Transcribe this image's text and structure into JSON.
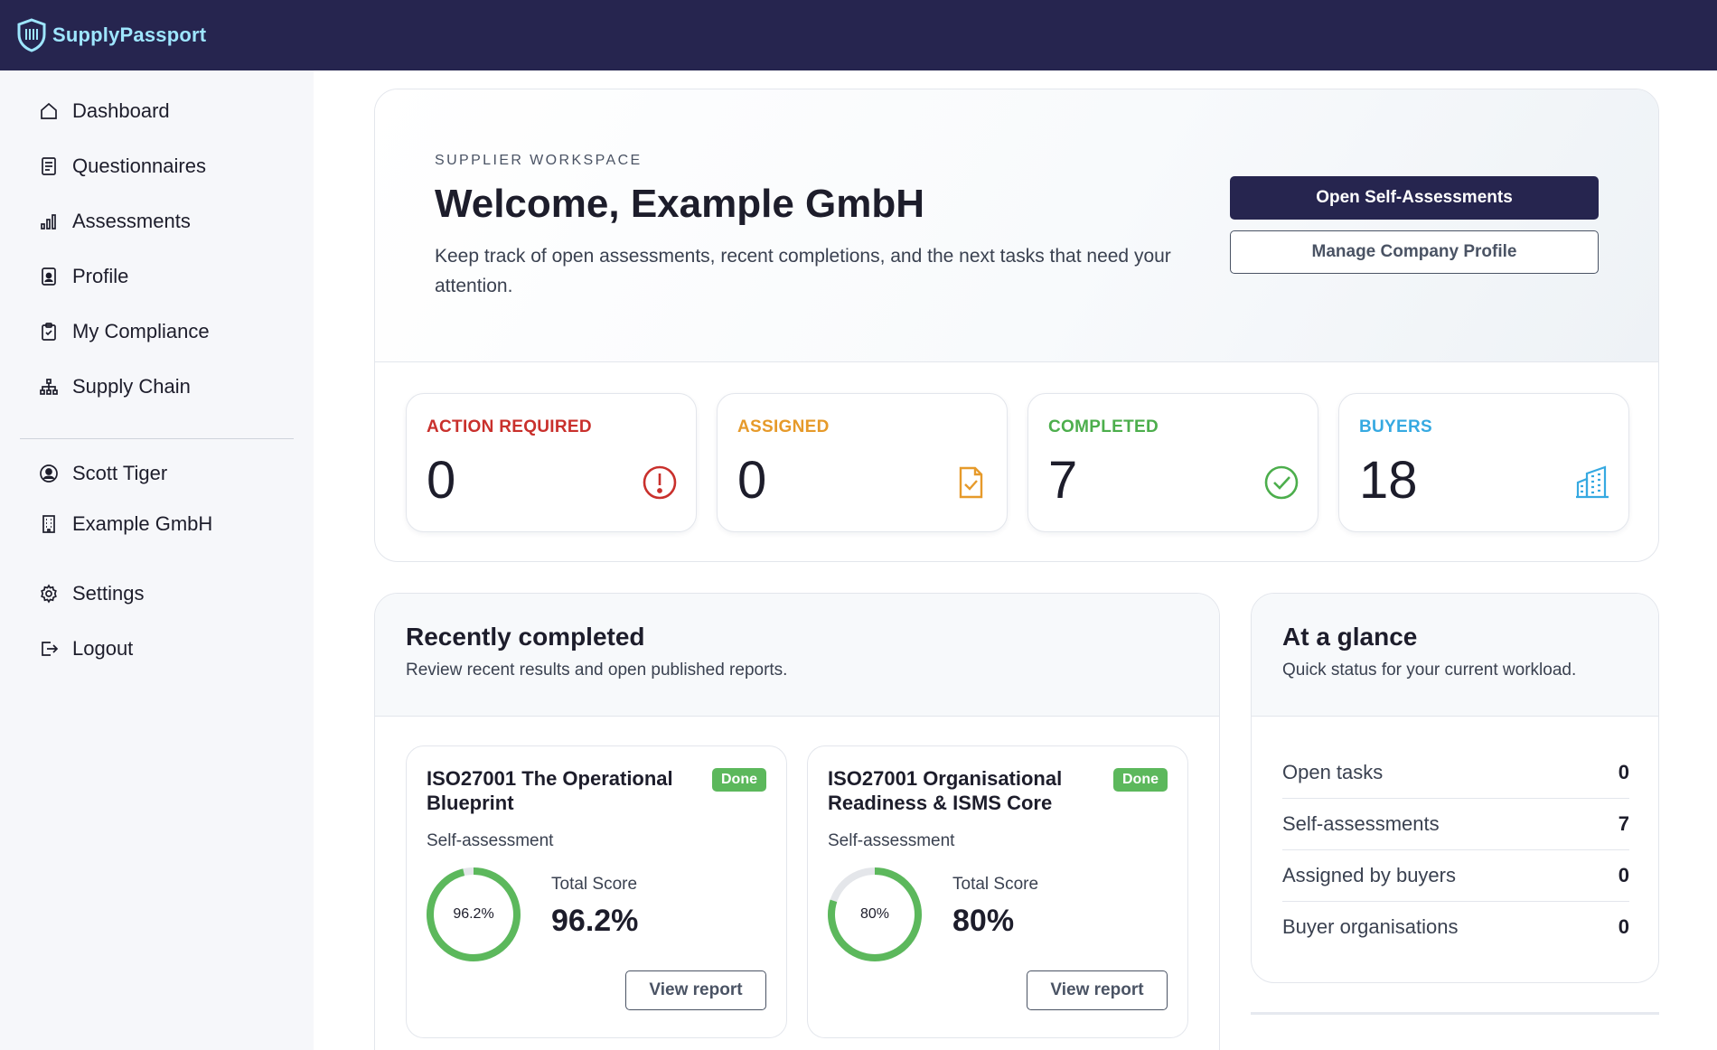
{
  "app": {
    "name": "SupplyPassport"
  },
  "sidebar": {
    "items": [
      {
        "label": "Dashboard",
        "icon": "home-icon"
      },
      {
        "label": "Questionnaires",
        "icon": "document-icon"
      },
      {
        "label": "Assessments",
        "icon": "bar-chart-icon"
      },
      {
        "label": "Profile",
        "icon": "id-badge-icon"
      },
      {
        "label": "My Compliance",
        "icon": "clipboard-check-icon"
      },
      {
        "label": "Supply Chain",
        "icon": "network-icon"
      }
    ],
    "user": {
      "name": "Scott Tiger",
      "company": "Example GmbH"
    },
    "settings_label": "Settings",
    "logout_label": "Logout"
  },
  "hero": {
    "eyebrow": "SUPPLIER WORKSPACE",
    "title": "Welcome, Example GmbH",
    "description": "Keep track of open assessments, recent completions, and the next tasks that need your attention.",
    "primary_button": "Open Self-Assessments",
    "secondary_button": "Manage Company Profile"
  },
  "stats": [
    {
      "label": "ACTION REQUIRED",
      "value": "0",
      "color": "#c9302c",
      "icon": "alert-circle-icon"
    },
    {
      "label": "ASSIGNED",
      "value": "0",
      "color": "#e69a2a",
      "icon": "file-check-icon"
    },
    {
      "label": "COMPLETED",
      "value": "7",
      "color": "#4cae4c",
      "icon": "check-circle-icon"
    },
    {
      "label": "BUYERS",
      "value": "18",
      "color": "#36a9e1",
      "icon": "buildings-icon"
    }
  ],
  "recent": {
    "title": "Recently completed",
    "subtitle": "Review recent results and open published reports.",
    "cards": [
      {
        "title": "ISO27001 The Operational Blueprint",
        "badge": "Done",
        "type": "Self-assessment",
        "score_label": "Total Score",
        "score_text": "96.2%",
        "score": 96.2,
        "button": "View report"
      },
      {
        "title": "ISO27001 Organisational Readiness & ISMS Core",
        "badge": "Done",
        "type": "Self-assessment",
        "score_label": "Total Score",
        "score_text": "80%",
        "score": 80,
        "button": "View report"
      }
    ]
  },
  "glance": {
    "title": "At a glance",
    "subtitle": "Quick status for your current workload.",
    "rows": [
      {
        "label": "Open tasks",
        "value": "0"
      },
      {
        "label": "Self-assessments",
        "value": "7"
      },
      {
        "label": "Assigned by buyers",
        "value": "0"
      },
      {
        "label": "Buyer organisations",
        "value": "0"
      }
    ]
  },
  "colors": {
    "navy": "#26254f",
    "brand_text": "#9ee6ff",
    "success": "#5cb85c"
  }
}
